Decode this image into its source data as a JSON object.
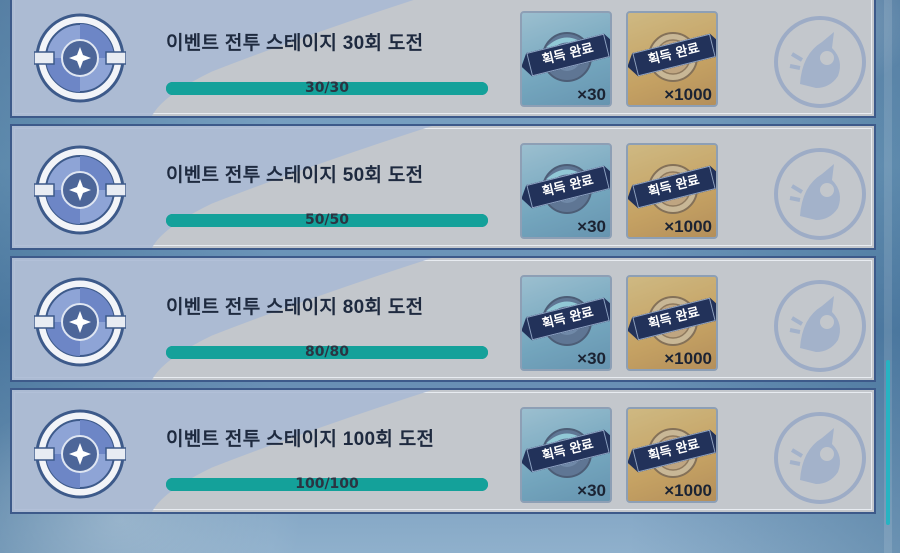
{
  "challenges": [
    {
      "title": "이벤트 전투 스테이지 30회 도전",
      "progress_text": "30/30",
      "progress": 1.0,
      "rewards": [
        {
          "badge": "획득 완료",
          "qty": "×30",
          "icon": "orb-icon"
        },
        {
          "badge": "획득 완료",
          "qty": "×1000",
          "icon": "coin-icon"
        }
      ]
    },
    {
      "title": "이벤트 전투 스테이지 50회 도전",
      "progress_text": "50/50",
      "progress": 1.0,
      "rewards": [
        {
          "badge": "획득 완료",
          "qty": "×30",
          "icon": "orb-icon"
        },
        {
          "badge": "획득 완료",
          "qty": "×1000",
          "icon": "coin-icon"
        }
      ]
    },
    {
      "title": "이벤트 전투 스테이지 80회 도전",
      "progress_text": "80/80",
      "progress": 1.0,
      "rewards": [
        {
          "badge": "획득 완료",
          "qty": "×30",
          "icon": "orb-icon"
        },
        {
          "badge": "획득 완료",
          "qty": "×1000",
          "icon": "coin-icon"
        }
      ]
    },
    {
      "title": "이벤트 전투 스테이지 100회 도전",
      "progress_text": "100/100",
      "progress": 1.0,
      "rewards": [
        {
          "badge": "획득 완료",
          "qty": "×30",
          "icon": "orb-icon"
        },
        {
          "badge": "획득 완료",
          "qty": "×1000",
          "icon": "coin-icon"
        }
      ]
    }
  ],
  "colors": {
    "bar": "#0e8e8b",
    "card": "#c3c7cc",
    "border": "#3d5a8a",
    "badge": "#22325a"
  }
}
